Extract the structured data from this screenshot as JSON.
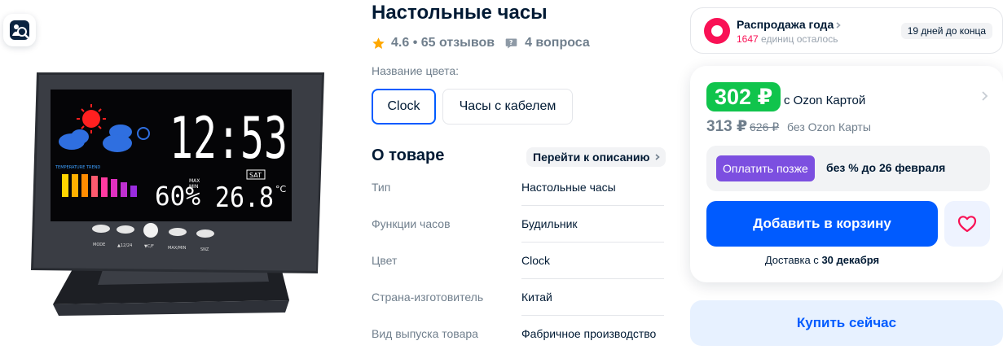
{
  "product": {
    "title": "Настольные часы",
    "rating": "4.6",
    "reviews": "65 отзывов",
    "questions": "4 вопроса"
  },
  "color_selector": {
    "label": "Название цвета:",
    "options": [
      "Clock",
      "Часы с кабелем"
    ],
    "selected": "Clock"
  },
  "about": {
    "title": "О товаре",
    "link_label": "Перейти к описанию",
    "specs": [
      {
        "key": "Тип",
        "value": "Настольные часы"
      },
      {
        "key": "Функции часов",
        "value": "Будильник"
      },
      {
        "key": "Цвет",
        "value": "Clock"
      },
      {
        "key": "Страна-изготовитель",
        "value": "Китай"
      },
      {
        "key": "Вид выпуска товара",
        "value": "Фабричное производство"
      }
    ]
  },
  "clock_display": {
    "time": "12:53",
    "humidity": "60%",
    "temperature": "26.8",
    "temp_unit": "°C",
    "day": "SAT",
    "trend_label": "TEMPERATURE TREND",
    "buttons": [
      "MODE",
      "▲12/24",
      "▼C/F",
      "MAX/MIN",
      "SNZ"
    ],
    "max_label": "MAX",
    "min_label": "MIN"
  },
  "sale": {
    "name": "Распродажа года",
    "stock_count": "1647",
    "stock_text": "единиц осталось",
    "days_left": "19 дней до конца"
  },
  "pricing": {
    "ozon_card_price": "302 ₽",
    "ozon_card_label": "с Ozon Картой",
    "price": "313 ₽",
    "old_price": "626 ₽",
    "no_card_label": "без Ozon Карты",
    "pay_later_button": "Оплатить позже",
    "pay_later_text": "без % до 26 февраля",
    "add_to_cart": "Добавить в корзину",
    "delivery_prefix": "Доставка с",
    "delivery_date": "30 декабря",
    "buy_now": "Купить сейчас"
  },
  "colors": {
    "accent": "#005bff",
    "ozon_green": "#10c44c",
    "sale_pink": "#f91155",
    "pay_later_purple": "#7c4fe0",
    "muted": "#707f8d"
  },
  "icons": [
    "visual-search-icon",
    "star-icon",
    "question-icon",
    "chevron-right-icon",
    "heart-icon",
    "sale-logo-icon"
  ]
}
